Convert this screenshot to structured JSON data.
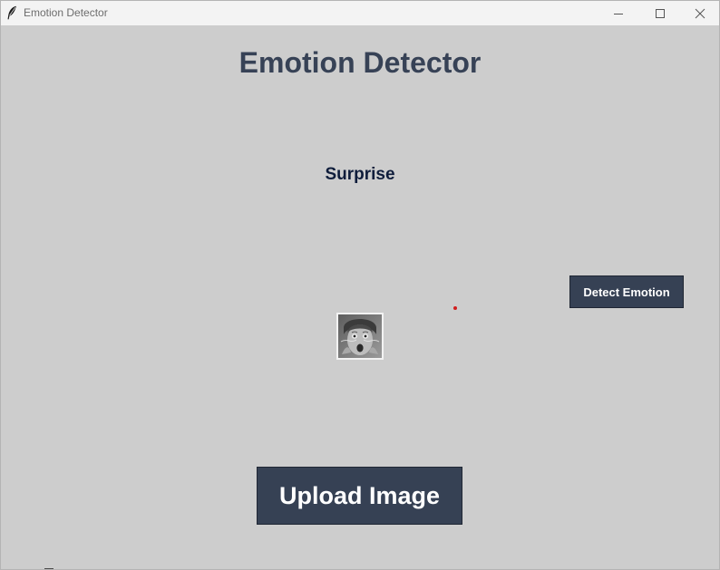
{
  "window": {
    "title": "Emotion Detector",
    "icons": {
      "app": "feather-icon",
      "minimize": "minimize-icon",
      "maximize": "maximize-icon",
      "close": "close-icon"
    }
  },
  "main": {
    "heading": "Emotion Detector",
    "result_label": "Surprise",
    "detect_button_label": "Detect Emotion",
    "upload_button_label": "Upload Image",
    "image": {
      "alt": "Uploaded face image showing a surprised child"
    }
  },
  "colors": {
    "background": "#cdcdcd",
    "button": "#364154",
    "heading": "#374256",
    "result": "#0f1d3b",
    "marker": "#d11d1d"
  }
}
